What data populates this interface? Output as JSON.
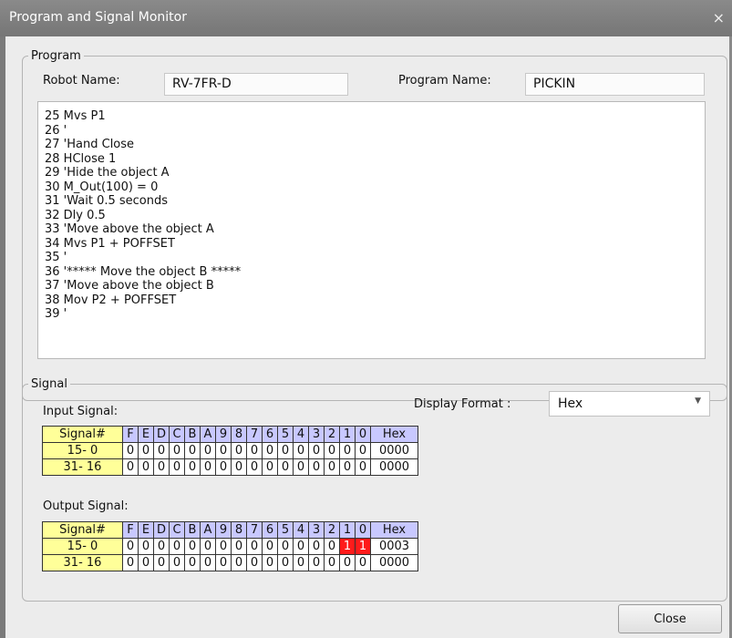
{
  "window": {
    "title": "Program and Signal Monitor",
    "close_glyph": "×"
  },
  "program": {
    "legend": "Program",
    "robot_name_label": "Robot Name:",
    "robot_name_value": "RV-7FR-D",
    "program_name_label": "Program Name:",
    "program_name_value": "PICKIN",
    "lines": [
      "25 Mvs P1",
      "26 '",
      "27 'Hand Close",
      "28 HClose 1",
      "29 'Hide the object A",
      "30 M_Out(100) = 0",
      "31 'Wait 0.5 seconds",
      "32 Dly 0.5",
      "33 'Move above the object A",
      "34 Mvs P1 + POFFSET",
      "35 '",
      "36 '***** Move the object B *****",
      "37 'Move above the object B",
      "38 Mov P2 + POFFSET",
      "39 '"
    ]
  },
  "signal": {
    "legend": "Signal",
    "input_label": "Input Signal:",
    "output_label": "Output Signal:",
    "display_format_label": "Display Format :",
    "display_format_value": "Hex",
    "headers": [
      "Signal#",
      "F",
      "E",
      "D",
      "C",
      "B",
      "A",
      "9",
      "8",
      "7",
      "6",
      "5",
      "4",
      "3",
      "2",
      "1",
      "0",
      "Hex"
    ],
    "input_rows": [
      {
        "label": "15-  0",
        "bits": [
          "0",
          "0",
          "0",
          "0",
          "0",
          "0",
          "0",
          "0",
          "0",
          "0",
          "0",
          "0",
          "0",
          "0",
          "0",
          "0"
        ],
        "hex": "0000"
      },
      {
        "label": "31- 16",
        "bits": [
          "0",
          "0",
          "0",
          "0",
          "0",
          "0",
          "0",
          "0",
          "0",
          "0",
          "0",
          "0",
          "0",
          "0",
          "0",
          "0"
        ],
        "hex": "0000"
      }
    ],
    "output_rows": [
      {
        "label": "15-  0",
        "bits": [
          "0",
          "0",
          "0",
          "0",
          "0",
          "0",
          "0",
          "0",
          "0",
          "0",
          "0",
          "0",
          "0",
          "0",
          "1",
          "1"
        ],
        "hex": "0003"
      },
      {
        "label": "31- 16",
        "bits": [
          "0",
          "0",
          "0",
          "0",
          "0",
          "0",
          "0",
          "0",
          "0",
          "0",
          "0",
          "0",
          "0",
          "0",
          "0",
          "0"
        ],
        "hex": "0000"
      }
    ],
    "on_color": "#ff1b1b"
  },
  "buttons": {
    "close_label": "Close"
  }
}
